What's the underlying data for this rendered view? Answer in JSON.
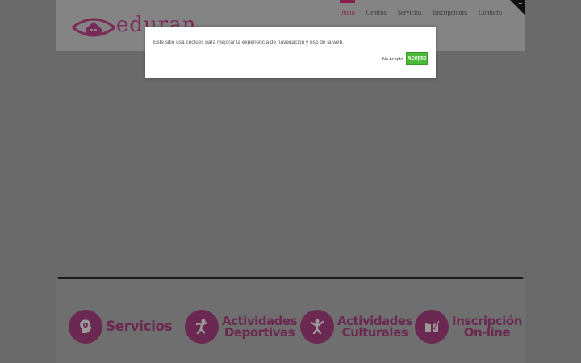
{
  "header": {
    "logo_text": "eduran",
    "nav": [
      {
        "label": "Inicio",
        "active": true
      },
      {
        "label": "Centros",
        "active": false
      },
      {
        "label": "Servicios",
        "active": false
      },
      {
        "label": "Inscripciones",
        "active": false
      },
      {
        "label": "Contacto",
        "active": false
      }
    ],
    "corner_symbol": "+"
  },
  "features": [
    {
      "lines": [
        "Servicios"
      ],
      "icon": "gear-head-icon"
    },
    {
      "lines": [
        "Actividades",
        "Deportivas"
      ],
      "icon": "runner-icon"
    },
    {
      "lines": [
        "Actividades",
        "Culturales"
      ],
      "icon": "dancer-icon"
    },
    {
      "lines": [
        "Inscripción",
        "On-line"
      ],
      "icon": "book-pen-icon"
    }
  ],
  "cookie": {
    "message": "Este sitio usa cookies para mejorar la experiencia de navegación y uso de la web.",
    "decline_label": "No Acepto",
    "accept_label": "Acepto"
  },
  "colors": {
    "brand": "#6b2952",
    "accept": "#4cb83a",
    "backdrop": "#6a6a6a"
  }
}
